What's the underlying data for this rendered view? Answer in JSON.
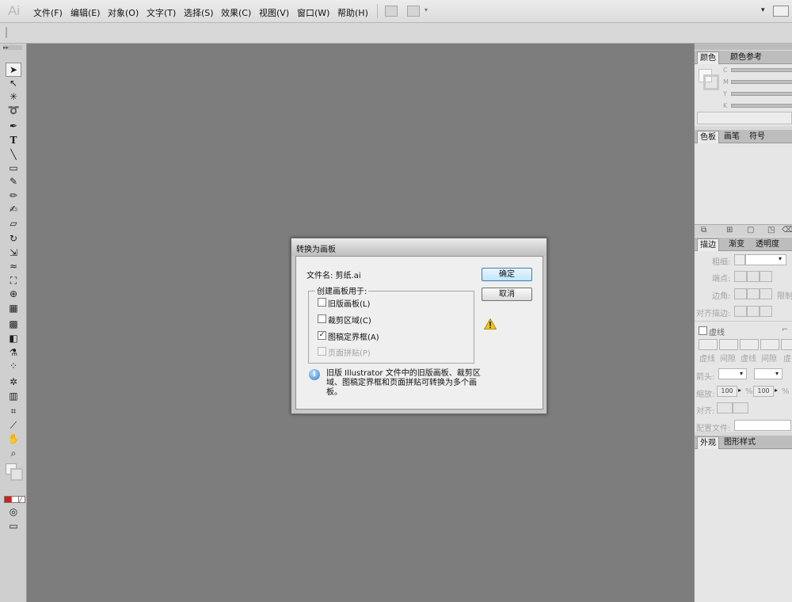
{
  "app": {
    "logo": "Ai"
  },
  "menubar": {
    "items": [
      "文件(F)",
      "编辑(E)",
      "对象(O)",
      "文字(T)",
      "选择(S)",
      "效果(C)",
      "视图(V)",
      "窗口(W)",
      "帮助(H)"
    ],
    "right_arrow": "▾"
  },
  "right_panel": {
    "color_tabs": [
      "颜色",
      "颜色参考"
    ],
    "cmyk_labels": [
      "C",
      "M",
      "Y",
      "K"
    ],
    "swatch_tabs": [
      "色板",
      "画笔",
      "符号"
    ],
    "stroke_tabs": [
      "描边",
      "渐变",
      "透明度"
    ],
    "stroke": {
      "weight_label": "粗细:",
      "cap_label": "端点:",
      "corner_label": "边角:",
      "limit_label": "限制",
      "align_label": "对齐描边:",
      "dashed_label": "虚线",
      "dash_labels": [
        "虚线",
        "间隙",
        "虚线",
        "间隙",
        "虚"
      ],
      "arrow_label": "箭头:",
      "scale_label": "缩放:",
      "scale_value_1": "100",
      "scale_value_2": "100",
      "percent": "%",
      "align2_label": "对齐:",
      "profile_label": "配置文件:"
    },
    "appearance_tabs": [
      "外观",
      "图形样式"
    ]
  },
  "dialog": {
    "title": "转换为画板",
    "file_label": "文件名: 剪纸.ai",
    "group_label": "创建画板用于:",
    "options": [
      {
        "label": "旧版画板(L)",
        "checked": false,
        "disabled": false
      },
      {
        "label": "裁剪区域(C)",
        "checked": false,
        "disabled": false
      },
      {
        "label": "图稿定界框(A)",
        "checked": true,
        "disabled": false
      },
      {
        "label": "页面拼贴(P)",
        "checked": false,
        "disabled": true
      }
    ],
    "ok_label": "确定",
    "cancel_label": "取消",
    "info_icon_glyph": "i",
    "info_text": "旧版 Illustrator 文件中的旧版画板、裁剪区域、图稿定界框和页面拼贴可转换为多个画板。"
  },
  "colors": {
    "canvas": "#7d7d7d",
    "default_button": "#bee6fd",
    "warning": "#f2c418"
  }
}
